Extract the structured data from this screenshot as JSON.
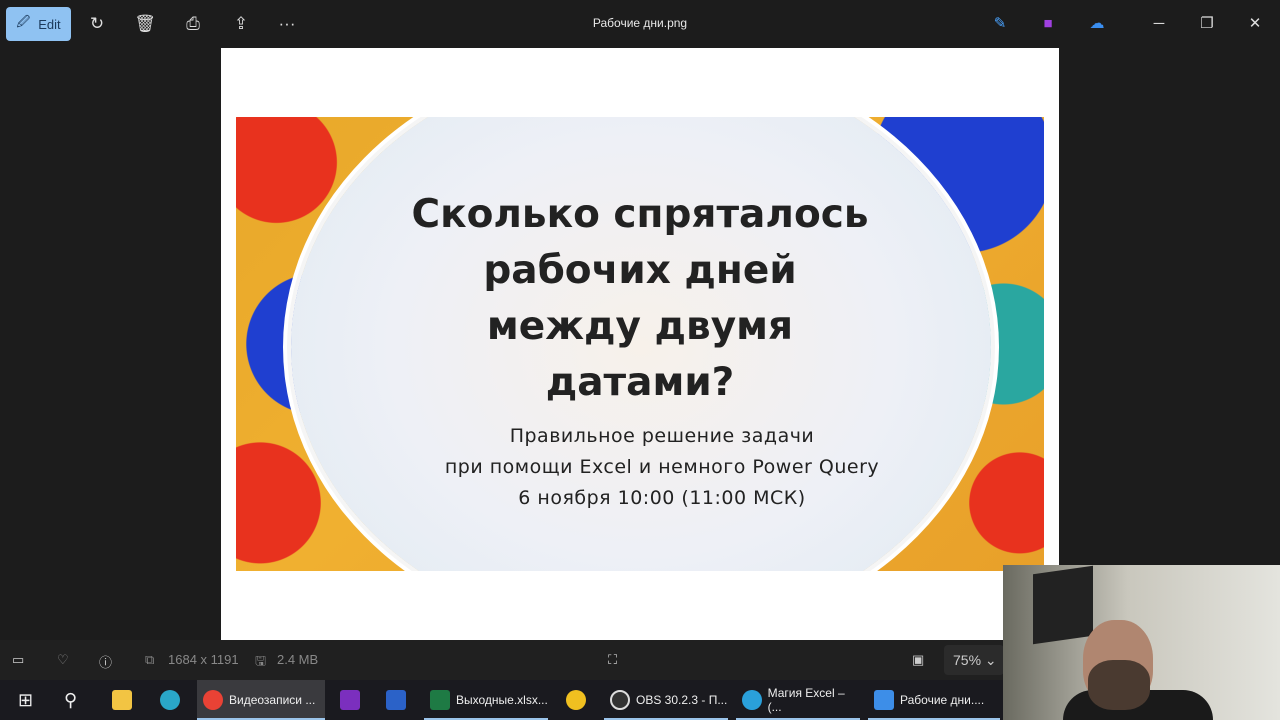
{
  "toolbar": {
    "edit_label": "Edit",
    "icons": [
      "rotate-icon",
      "delete-icon",
      "print-icon",
      "share-icon",
      "more-icon"
    ],
    "more": "···"
  },
  "window": {
    "title": "Рабочие дни.png",
    "min": "─",
    "restore": "❐",
    "close": "✕"
  },
  "slide": {
    "title_lines": [
      "Сколько спряталось",
      "рабочих дней",
      "между двумя",
      "датами?"
    ],
    "subtitle_lines": [
      "Правильное решение задачи",
      "при помощи Excel и немного Power Query",
      "6 ноября 10:00 (11:00 МСК)"
    ]
  },
  "status": {
    "dimensions": "1684 x 1191",
    "file_size": "2.4 MB",
    "zoom": "75%"
  },
  "taskbar": {
    "items": [
      {
        "label": "Видеозаписи ...",
        "color": "#e94235"
      },
      {
        "label": "",
        "color": "#7b2fbe"
      },
      {
        "label": "",
        "color": "#2b62c8"
      },
      {
        "label": "Выходные.xlsx...",
        "color": "#1e7a44"
      },
      {
        "label": "",
        "color": "#f0c020"
      },
      {
        "label": "OBS 30.2.3 - П...",
        "color": "#333333"
      },
      {
        "label": "Магия Excel – (...",
        "color": "#2aa0da"
      },
      {
        "label": "Рабочие дни....",
        "color": "#3d8ee8"
      }
    ]
  }
}
